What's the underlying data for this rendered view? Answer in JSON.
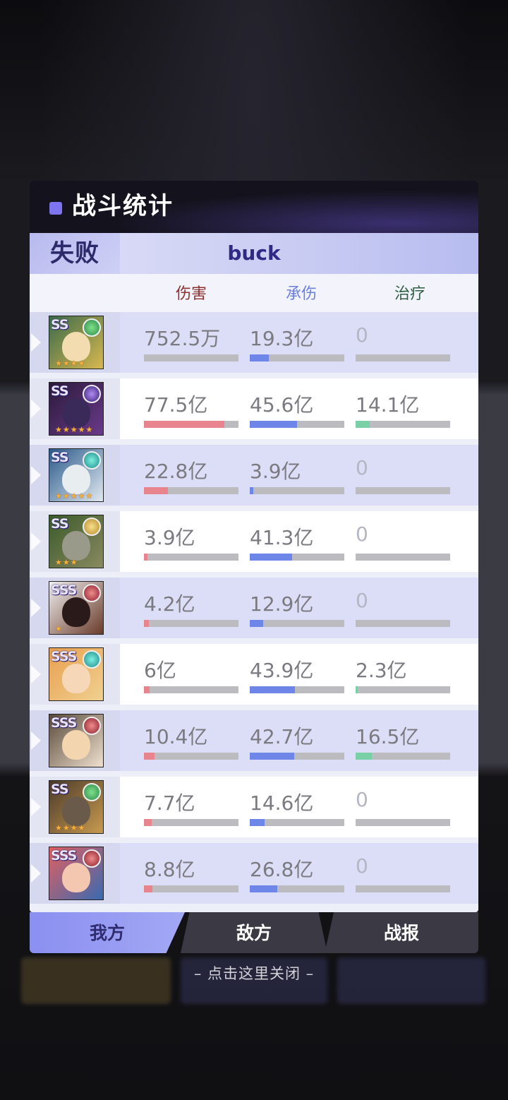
{
  "panel": {
    "title": "战斗统计",
    "result_label": "失败",
    "player_name": "buck"
  },
  "columns": {
    "damage": "伤害",
    "taken": "承伤",
    "heal": "治疗"
  },
  "colors": {
    "damage": "#e8848e",
    "taken": "#6e86e8",
    "heal": "#7ad0a6",
    "damage_header": "#8a3030",
    "taken_header": "#6b7fe0",
    "heal_header": "#2f5e44"
  },
  "heroes": [
    {
      "rank": "SS",
      "element": "nature",
      "stars": "★★★★",
      "damage": "752.5万",
      "taken": "19.3亿",
      "heal": "0",
      "damage_pct": 0.003,
      "taken_pct": 0.2,
      "heal_pct": 0
    },
    {
      "rank": "SS",
      "element": "dark",
      "stars": "★★★★★",
      "damage": "77.5亿",
      "taken": "45.6亿",
      "heal": "14.1亿",
      "damage_pct": 0.85,
      "taken_pct": 0.5,
      "heal_pct": 0.15
    },
    {
      "rank": "SS",
      "element": "wind",
      "stars": "★★★★★",
      "damage": "22.8亿",
      "taken": "3.9亿",
      "heal": "0",
      "damage_pct": 0.25,
      "taken_pct": 0.04,
      "heal_pct": 0
    },
    {
      "rank": "SS",
      "element": "light",
      "stars": "★★★",
      "damage": "3.9亿",
      "taken": "41.3亿",
      "heal": "0",
      "damage_pct": 0.04,
      "taken_pct": 0.45,
      "heal_pct": 0
    },
    {
      "rank": "SSS",
      "element": "fire",
      "stars": "★",
      "damage": "4.2亿",
      "taken": "12.9亿",
      "heal": "0",
      "damage_pct": 0.05,
      "taken_pct": 0.14,
      "heal_pct": 0
    },
    {
      "rank": "SSS",
      "element": "wind",
      "stars": "",
      "damage": "6亿",
      "taken": "43.9亿",
      "heal": "2.3亿",
      "damage_pct": 0.06,
      "taken_pct": 0.48,
      "heal_pct": 0.02
    },
    {
      "rank": "SSS",
      "element": "fire",
      "stars": "",
      "damage": "10.4亿",
      "taken": "42.7亿",
      "heal": "16.5亿",
      "damage_pct": 0.11,
      "taken_pct": 0.47,
      "heal_pct": 0.17
    },
    {
      "rank": "SS",
      "element": "nature",
      "stars": "★★★★",
      "damage": "7.7亿",
      "taken": "14.6亿",
      "heal": "0",
      "damage_pct": 0.08,
      "taken_pct": 0.16,
      "heal_pct": 0
    },
    {
      "rank": "SSS",
      "element": "fire",
      "stars": "",
      "damage": "8.8亿",
      "taken": "26.8亿",
      "heal": "0",
      "damage_pct": 0.09,
      "taken_pct": 0.29,
      "heal_pct": 0
    }
  ],
  "tabs": [
    "我方",
    "敌方",
    "战报"
  ],
  "close_hint": "– 点击这里关闭 –"
}
